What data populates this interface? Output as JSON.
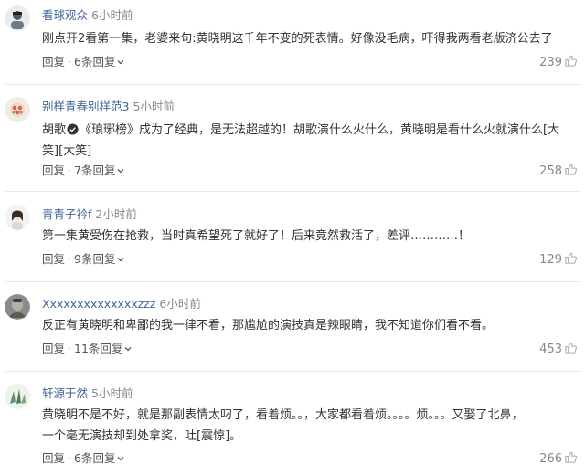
{
  "comments": [
    {
      "username": "看球观众",
      "time": "6小时前",
      "text": "刚点开2看第一集，老婆来句:黄晓明这千年不变的死表情。好像没毛病，吓得我两看老版济公去了",
      "reply": "回复",
      "replies": "6条回复",
      "likes": "239"
    },
    {
      "username": "别样青春别样范3",
      "time": "5小时前",
      "text_line1_a": "胡歌",
      "text_line1_b": "《琅琊榜》成为了经典，是无法超越的！胡歌演什么火什么，黄晓明是看什么火就演什么[大",
      "text_line2": "笑][大笑]",
      "reply": "回复",
      "replies": "7条回复",
      "likes": "258"
    },
    {
      "username": "青青子衿f",
      "time": "2小时前",
      "text": "第一集黄受伤在抢救，当时真希望死了就好了！后来竟然救活了，差评…………！",
      "reply": "回复",
      "replies": "9条回复",
      "likes": "129"
    },
    {
      "username": "Xxxxxxxxxxxxxxzzz",
      "time": "6小时前",
      "text": "反正有黄晓明和卑鄙的我一律不看，那尴尬的演技真是辣眼睛，我不知道你们看不看。",
      "reply": "回复",
      "replies": "11条回复",
      "likes": "453"
    },
    {
      "username": "轩源于然",
      "time": "5小时前",
      "text_line1": "黄晓明不是不好，就是那副表情太叼了，看着烦。。，大家都看着烦。。。。烦。。。又娶了北鼻，",
      "text_line2": "一个毫无演技却到处拿奖，吐[震惊]。",
      "reply": "回复",
      "replies": "6条回复",
      "likes": "266"
    }
  ],
  "icons": {
    "like": "thumbs-up-icon",
    "expand": "chevron-down-icon",
    "badge": "verified-badge-icon"
  },
  "colors": {
    "username": "#406599",
    "text": "#333333",
    "meta": "#888888",
    "divider": "#e6e6e6"
  }
}
